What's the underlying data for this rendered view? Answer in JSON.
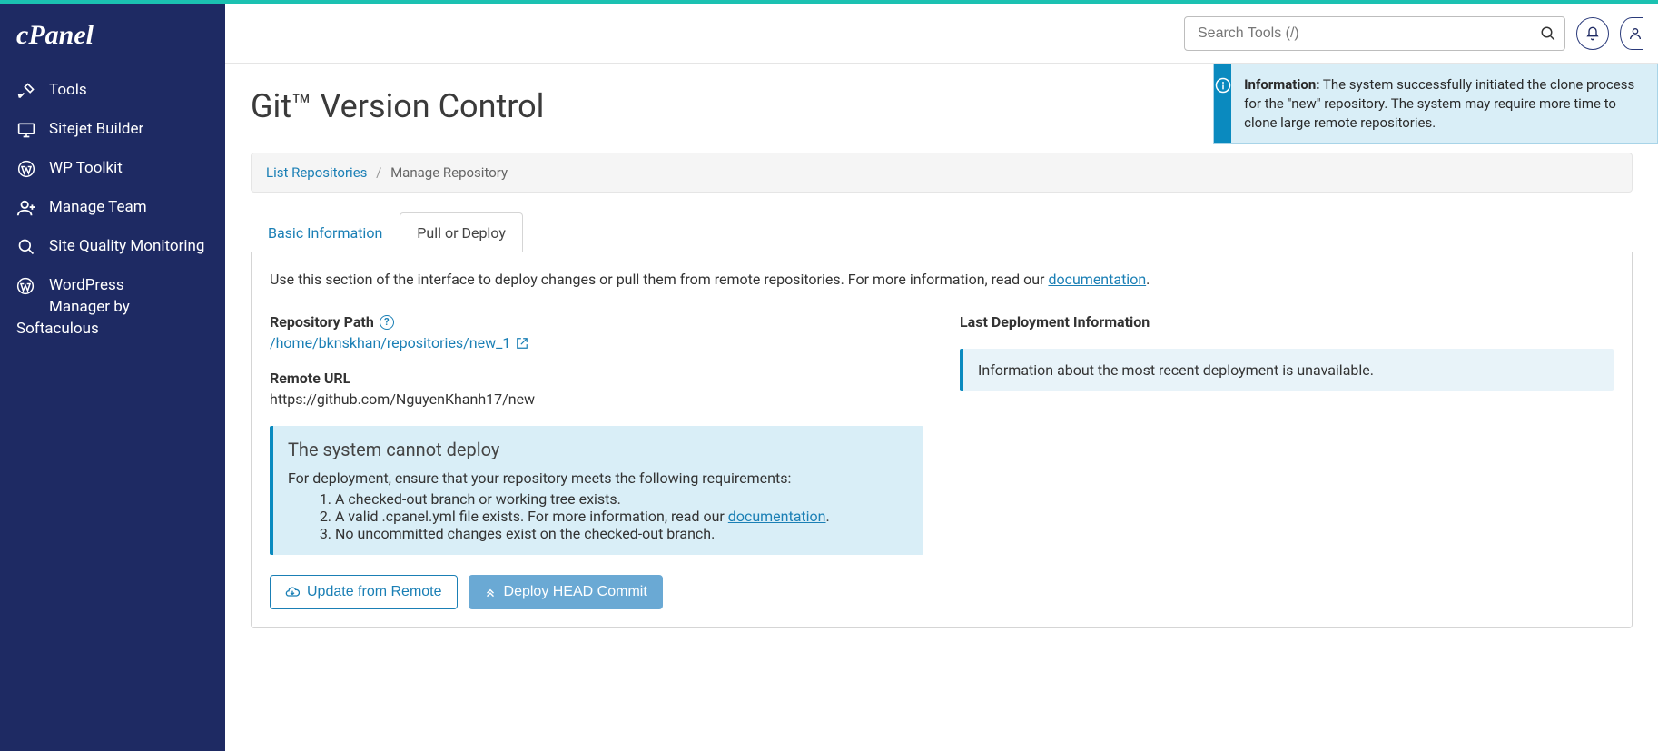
{
  "brand": "cPanel",
  "sidebar": {
    "items": [
      {
        "label": "Tools",
        "icon": "tools-icon"
      },
      {
        "label": "Sitejet Builder",
        "icon": "monitor-icon"
      },
      {
        "label": "WP Toolkit",
        "icon": "wordpress-icon"
      },
      {
        "label": "Manage Team",
        "icon": "team-icon"
      },
      {
        "label": "Site Quality Monitoring",
        "icon": "magnifier-icon"
      }
    ],
    "softaculous_line1": "WordPress",
    "softaculous_line2": "Manager by",
    "softaculous_line3": "Softaculous"
  },
  "search": {
    "placeholder": "Search Tools (/)"
  },
  "page": {
    "title": "Git™ Version Control",
    "breadcrumb": {
      "root": "List Repositories",
      "current": "Manage Repository"
    }
  },
  "toast": {
    "prefix": "Information:",
    "text": " The system successfully initiated the clone process for the \"new\" repository. The system may require more time to clone large remote repositories."
  },
  "tabs": {
    "basic": "Basic Information",
    "pull": "Pull or Deploy"
  },
  "panel": {
    "intro_pre": "Use this section of the interface to deploy changes or pull them from remote repositories. For more information, read our ",
    "intro_link": "documentation",
    "intro_post": ".",
    "repo_path_label": "Repository Path",
    "repo_path_value": "/home/bknskhan/repositories/new_1",
    "remote_url_label": "Remote URL",
    "remote_url_value": "https://github.com/NguyenKhanh17/new",
    "deploy_heading": "Last Deployment Information",
    "deploy_info_msg": "Information about the most recent deployment is unavailable.",
    "cannot_deploy_title": "The system cannot deploy",
    "cannot_deploy_intro": "For deployment, ensure that your repository meets the following requirements:",
    "req1": "A checked-out branch or working tree exists.",
    "req2_pre": "A valid .cpanel.yml file exists. For more information, read our ",
    "req2_link": "documentation",
    "req2_post": ".",
    "req3": "No uncommitted changes exist on the checked-out branch.",
    "btn_update": "Update from Remote",
    "btn_deploy": "Deploy HEAD Commit"
  }
}
